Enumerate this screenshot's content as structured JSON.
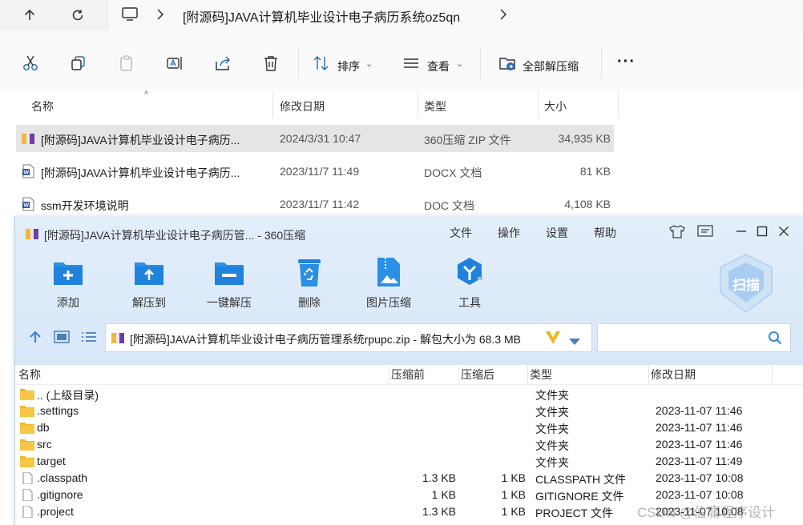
{
  "explorer": {
    "address": "[附源码]JAVA计算机毕业设计电子病历系统oz5qn",
    "commands": {
      "extract_menu_label": "排序",
      "view_label": "查看",
      "extract_all_label": "全部解压缩",
      "more_label": "···"
    },
    "columns": {
      "name": "名称",
      "modified": "修改日期",
      "type": "类型",
      "size": "大小"
    },
    "files": [
      {
        "name": "[附源码]JAVA计算机毕业设计电子病历...",
        "modified": "2024/3/31 10:47",
        "type": "360压缩 ZIP 文件",
        "size": "34,935 KB",
        "icon": "zip-icon"
      },
      {
        "name": "[附源码]JAVA计算机毕业设计电子病历...",
        "modified": "2023/11/7 11:49",
        "type": "DOCX 文档",
        "size": "81 KB",
        "icon": "word-icon"
      },
      {
        "name": "ssm开发环境说明",
        "modified": "2023/11/7 11:42",
        "type": "DOC 文档",
        "size": "4,108 KB",
        "icon": "word-icon"
      }
    ]
  },
  "zip_window": {
    "title": "[附源码]JAVA计算机毕业设计电子病历管... - 360压缩",
    "menu": [
      "文件",
      "操作",
      "设置",
      "帮助"
    ],
    "tools": [
      {
        "label": "添加",
        "icon": "add-folder-icon"
      },
      {
        "label": "解压到",
        "icon": "extract-to-icon"
      },
      {
        "label": "一键解压",
        "icon": "one-click-extract-icon"
      },
      {
        "label": "删除",
        "icon": "recycle-icon"
      },
      {
        "label": "图片压缩",
        "icon": "image-compress-icon"
      },
      {
        "label": "工具",
        "icon": "tools-icon"
      }
    ],
    "scan_label": "扫描",
    "path": "[附源码]JAVA计算机毕业设计电子病历管理系统rpupc.zip - 解包大小为 68.3 MB",
    "columns": {
      "name": "名称",
      "before": "压缩前",
      "after": "压缩后",
      "type": "类型",
      "modified": "修改日期"
    },
    "rows": [
      {
        "name": ".. (上级目录)",
        "before": "",
        "after": "",
        "type": "文件夹",
        "modified": "",
        "kind": "folder"
      },
      {
        "name": ".settings",
        "before": "",
        "after": "",
        "type": "文件夹",
        "modified": "2023-11-07 11:46",
        "kind": "folder"
      },
      {
        "name": "db",
        "before": "",
        "after": "",
        "type": "文件夹",
        "modified": "2023-11-07 11:46",
        "kind": "folder"
      },
      {
        "name": "src",
        "before": "",
        "after": "",
        "type": "文件夹",
        "modified": "2023-11-07 11:46",
        "kind": "folder"
      },
      {
        "name": "target",
        "before": "",
        "after": "",
        "type": "文件夹",
        "modified": "2023-11-07 11:49",
        "kind": "folder"
      },
      {
        "name": ".classpath",
        "before": "1.3 KB",
        "after": "1 KB",
        "type": "CLASSPATH 文件",
        "modified": "2023-11-07 10:08",
        "kind": "file"
      },
      {
        "name": ".gitignore",
        "before": "1 KB",
        "after": "1 KB",
        "type": "GITIGNORE 文件",
        "modified": "2023-11-07 10:08",
        "kind": "file"
      },
      {
        "name": ".project",
        "before": "1.3 KB",
        "after": "1 KB",
        "type": "PROJECT 文件",
        "modified": "2023-11-07 10:08",
        "kind": "file"
      }
    ]
  },
  "watermark": "CSDN @伯庸程序设计"
}
